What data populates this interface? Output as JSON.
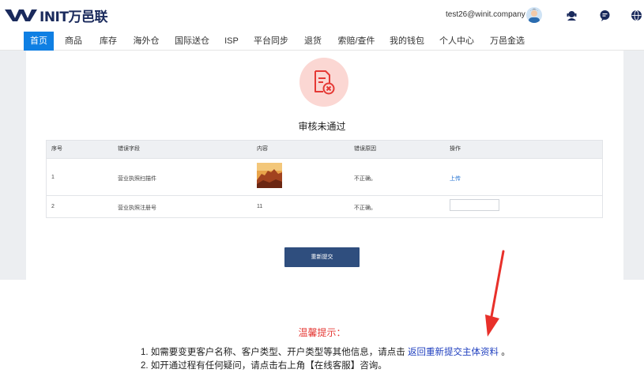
{
  "header": {
    "logo_text": "INIT万邑联",
    "user_email": "test26@winit.company"
  },
  "nav": {
    "items": [
      "首页",
      "商品",
      "库存",
      "海外仓",
      "国际送仓",
      "ISP",
      "平台同步",
      "退货",
      "索赔/查件",
      "我的钱包",
      "个人中心",
      "万邑金选"
    ],
    "active_index": 0
  },
  "status": {
    "title": "审核未通过"
  },
  "table": {
    "headers": [
      "序号",
      "错误字段",
      "内容",
      "错误原因",
      "操作"
    ],
    "rows": [
      {
        "index": "1",
        "field": "营业执照扫描件",
        "content": "",
        "reason": "不正确。",
        "action": "上传"
      },
      {
        "index": "2",
        "field": "营业执照注册号",
        "content": "11",
        "reason": "不正确。",
        "action": ""
      }
    ]
  },
  "buttons": {
    "resubmit": "重新提交"
  },
  "tips": {
    "title": "温馨提示：",
    "line1_prefix": "1. 如需要变更客户名称、客户类型、开户类型等其他信息，请点击",
    "line1_link": "返回重新提交主体资料",
    "line1_suffix": "。",
    "line2": "2. 如开通过程有任何疑问，请点击右上角【在线客服】咨询。"
  },
  "colors": {
    "nav_active": "#0f7fe3",
    "status_bg": "#fbd7d3",
    "status_icon": "#e53935",
    "button_bg": "#2f4e7e",
    "tips_title": "#e53935",
    "link": "#1f3fbf",
    "annotation_arrow": "#e8302a"
  }
}
